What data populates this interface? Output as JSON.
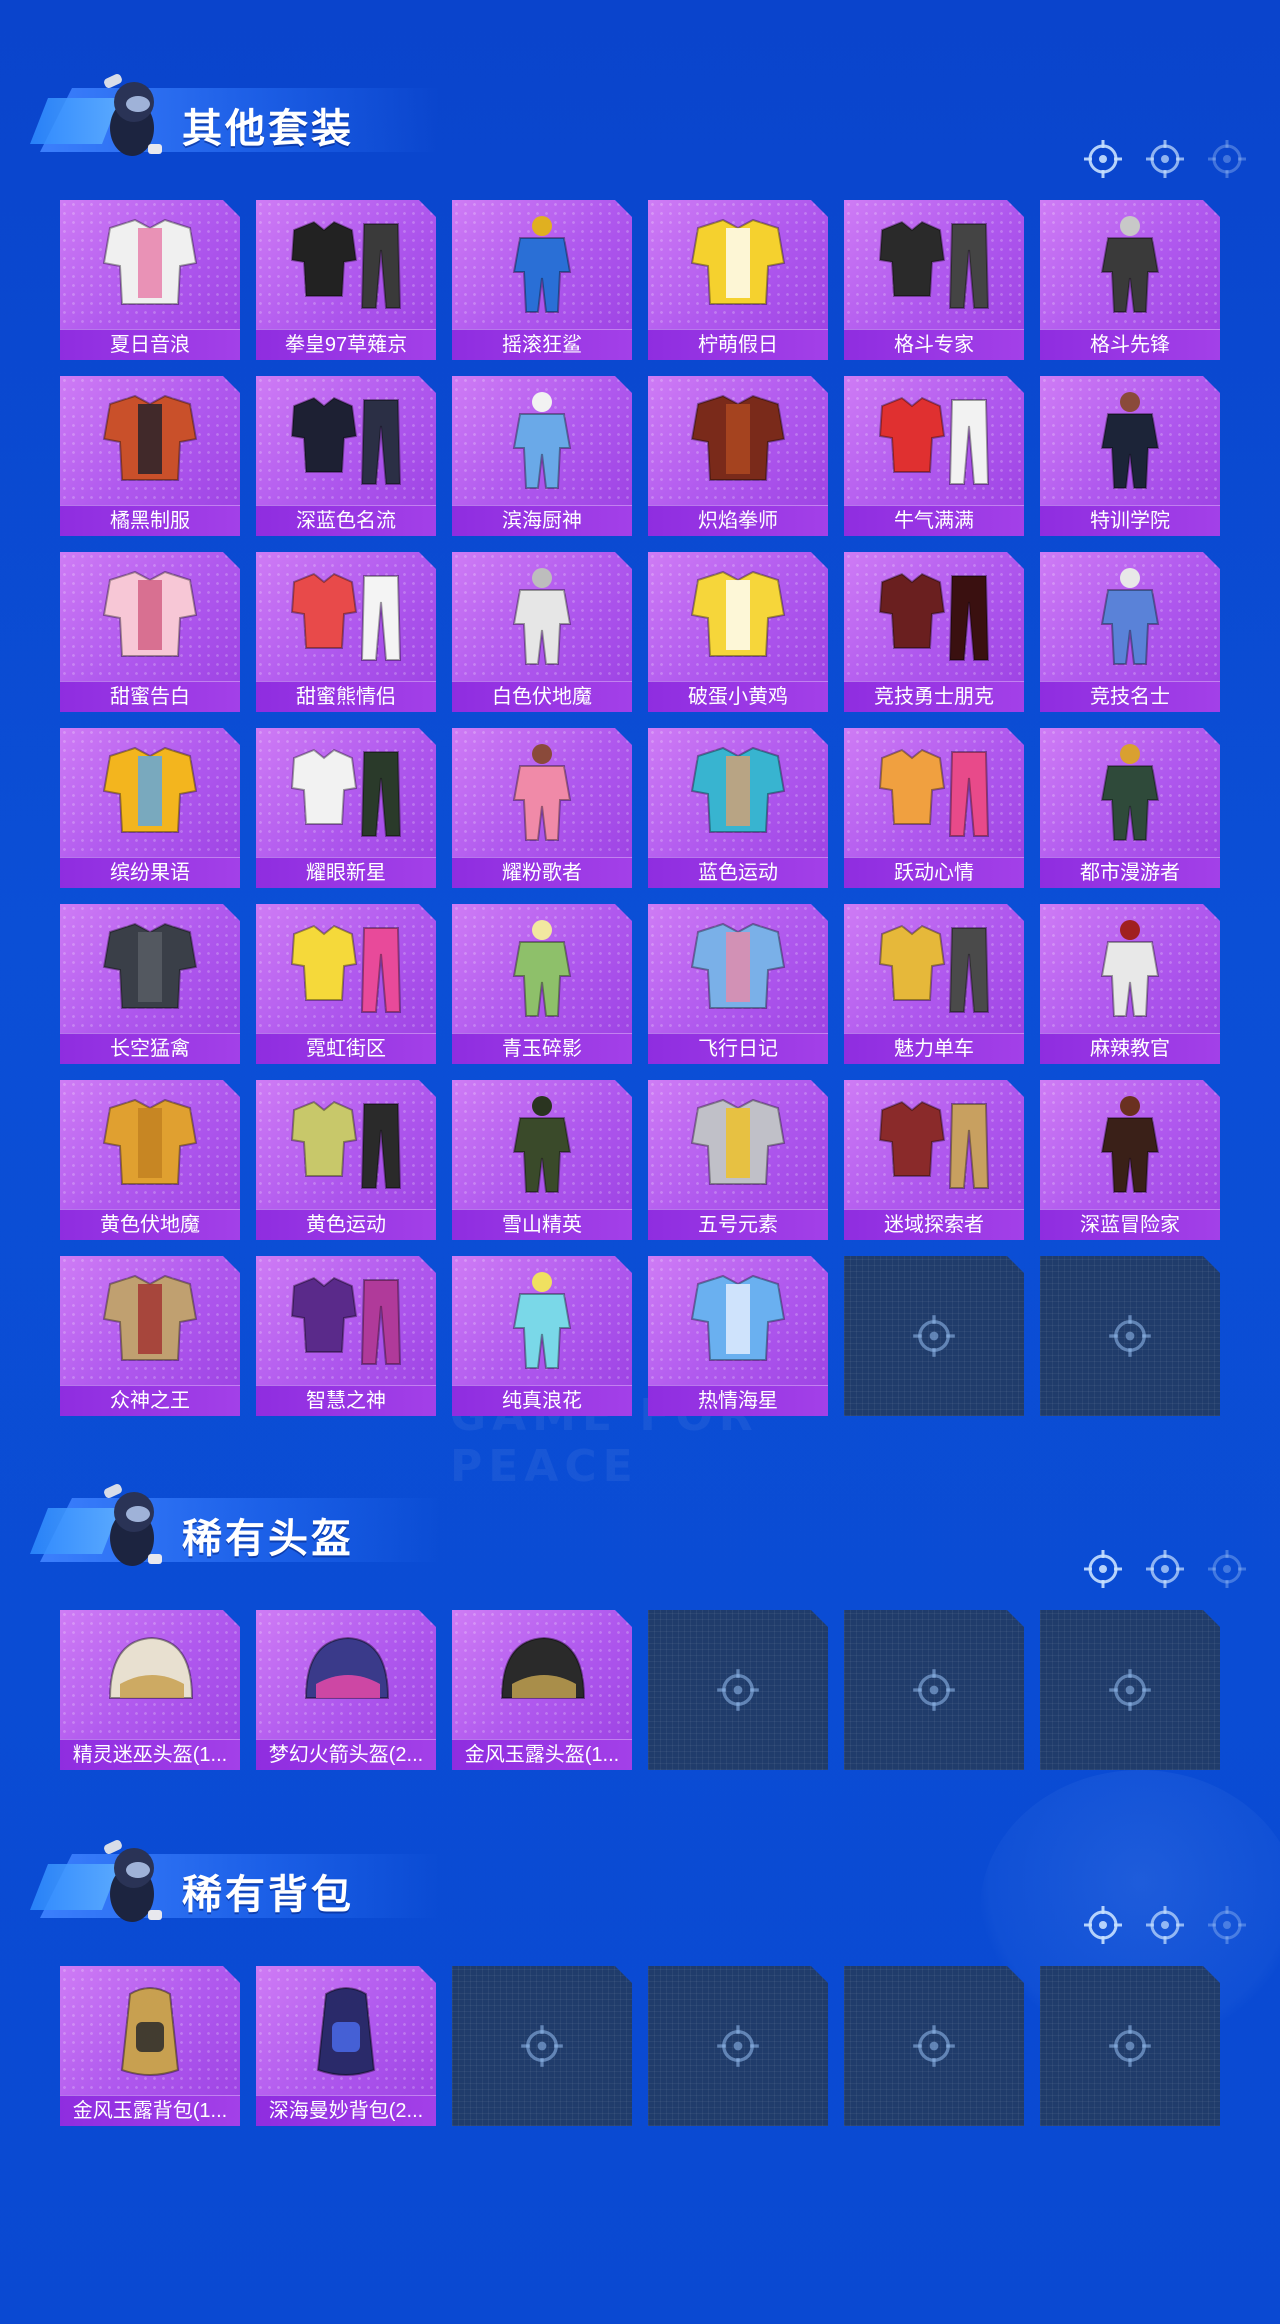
{
  "sections": [
    {
      "title": "其他套装",
      "items": [
        {
          "label": "夏日音浪",
          "colors": [
            "#f0f0f0",
            "#e77aa8"
          ]
        },
        {
          "label": "拳皇97草薙京",
          "colors": [
            "#222222",
            "#3a3a3a"
          ]
        },
        {
          "label": "摇滚狂鲨",
          "colors": [
            "#2a6fd6",
            "#e0b020"
          ]
        },
        {
          "label": "柠萌假日",
          "colors": [
            "#f5d12e",
            "#ffffff"
          ]
        },
        {
          "label": "格斗专家",
          "colors": [
            "#2a2a2a",
            "#444444"
          ]
        },
        {
          "label": "格斗先锋",
          "colors": [
            "#3a3a3a",
            "#c8c8c8"
          ]
        },
        {
          "label": "橘黑制服",
          "colors": [
            "#c9502a",
            "#1f1f2a"
          ]
        },
        {
          "label": "深蓝色名流",
          "colors": [
            "#1d2033",
            "#2b2f45"
          ]
        },
        {
          "label": "滨海厨神",
          "colors": [
            "#6aa9e8",
            "#f2f2f2"
          ]
        },
        {
          "label": "炽焰拳师",
          "colors": [
            "#7a2a1a",
            "#b04a20"
          ]
        },
        {
          "label": "牛气满满",
          "colors": [
            "#e03030",
            "#f2f2f2"
          ]
        },
        {
          "label": "特训学院",
          "colors": [
            "#1c2438",
            "#8a4a3a"
          ]
        },
        {
          "label": "甜蜜告白",
          "colors": [
            "#f7c7d6",
            "#d05a80"
          ]
        },
        {
          "label": "甜蜜熊情侣",
          "colors": [
            "#e84a4a",
            "#f4f4f4"
          ]
        },
        {
          "label": "白色伏地魔",
          "colors": [
            "#e6e6e6",
            "#bdbdbd"
          ]
        },
        {
          "label": "破蛋小黄鸡",
          "colors": [
            "#f6d63a",
            "#ffffff"
          ]
        },
        {
          "label": "竞技勇士朋克",
          "colors": [
            "#6a1f1f",
            "#3a1010"
          ]
        },
        {
          "label": "竞技名士",
          "colors": [
            "#5a82d8",
            "#e8e8e8"
          ]
        },
        {
          "label": "缤纷果语",
          "colors": [
            "#f3b51e",
            "#5aa6e6"
          ]
        },
        {
          "label": "耀眼新星",
          "colors": [
            "#f2f2f2",
            "#2a3a2a"
          ]
        },
        {
          "label": "耀粉歌者",
          "colors": [
            "#f08aa8",
            "#8a4a3a"
          ]
        },
        {
          "label": "蓝色运动",
          "colors": [
            "#38b4d0",
            "#d8a070"
          ]
        },
        {
          "label": "跃动心情",
          "colors": [
            "#f0a040",
            "#e84a8a"
          ]
        },
        {
          "label": "都市漫游者",
          "colors": [
            "#2f4a3a",
            "#d9a030"
          ]
        },
        {
          "label": "长空猛禽",
          "colors": [
            "#3a3f48",
            "#5a5f66"
          ]
        },
        {
          "label": "霓虹街区",
          "colors": [
            "#f5d93a",
            "#e84a9a"
          ]
        },
        {
          "label": "青玉碎影",
          "colors": [
            "#8ec06a",
            "#f2e8a0"
          ]
        },
        {
          "label": "飞行日记",
          "colors": [
            "#7ab0e8",
            "#e88aa8"
          ]
        },
        {
          "label": "魅力单车",
          "colors": [
            "#e6b83a",
            "#4a4a4a"
          ]
        },
        {
          "label": "麻辣教官",
          "colors": [
            "#e8e8e8",
            "#a02020"
          ]
        },
        {
          "label": "黄色伏地魔",
          "colors": [
            "#e0a030",
            "#c08020"
          ]
        },
        {
          "label": "黄色运动",
          "colors": [
            "#c8c86a",
            "#2a2a2a"
          ]
        },
        {
          "label": "雪山精英",
          "colors": [
            "#3a4a2a",
            "#2a3420"
          ]
        },
        {
          "label": "五号元素",
          "colors": [
            "#c0c0c8",
            "#f0c020"
          ]
        },
        {
          "label": "迷域探索者",
          "colors": [
            "#8a2a2a",
            "#c8a060"
          ]
        },
        {
          "label": "深蓝冒险家",
          "colors": [
            "#3a2018",
            "#6a3020"
          ]
        },
        {
          "label": "众神之王",
          "colors": [
            "#c0a070",
            "#a03030"
          ]
        },
        {
          "label": "智慧之神",
          "colors": [
            "#5a2a8a",
            "#b03a9a"
          ]
        },
        {
          "label": "纯真浪花",
          "colors": [
            "#7ad8e8",
            "#f0e060"
          ]
        },
        {
          "label": "热情海星",
          "colors": [
            "#6ab0f0",
            "#e8f0ff"
          ]
        },
        {
          "label": "",
          "empty": true
        },
        {
          "label": "",
          "empty": true
        }
      ]
    },
    {
      "title": "稀有头盔",
      "items": [
        {
          "label": "精灵迷巫头盔(1...",
          "colors": [
            "#e8e0d0",
            "#c8a050"
          ]
        },
        {
          "label": "梦幻火箭头盔(2...",
          "colors": [
            "#3a3a8a",
            "#e84aa8"
          ]
        },
        {
          "label": "金风玉露头盔(1...",
          "colors": [
            "#2a2a2a",
            "#c0a050"
          ]
        },
        {
          "label": "",
          "empty": true
        },
        {
          "label": "",
          "empty": true
        },
        {
          "label": "",
          "empty": true
        }
      ]
    },
    {
      "title": "稀有背包",
      "items": [
        {
          "label": "金风玉露背包(1...",
          "colors": [
            "#c8a050",
            "#2a2a2a"
          ]
        },
        {
          "label": "深海曼妙背包(2...",
          "colors": [
            "#2a2a6a",
            "#4a6ae8"
          ]
        },
        {
          "label": "",
          "empty": true
        },
        {
          "label": "",
          "empty": true
        },
        {
          "label": "",
          "empty": true
        },
        {
          "label": "",
          "empty": true
        }
      ]
    }
  ],
  "watermark": "GAME FOR PEACE"
}
